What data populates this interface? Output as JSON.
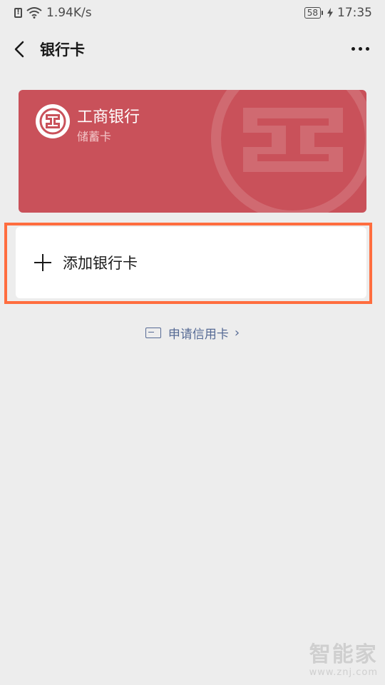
{
  "status_bar": {
    "network_speed": "1.94K/s",
    "battery": "58",
    "time": "17:35"
  },
  "nav": {
    "title": "银行卡"
  },
  "card": {
    "bank_name": "工商银行",
    "card_type": "储蓄卡",
    "color": "#c9515a"
  },
  "add_card": {
    "label": "添加银行卡"
  },
  "credit_link": {
    "label": "申请信用卡"
  },
  "watermark": {
    "title": "智能家",
    "url": "www.znj.com"
  },
  "colors": {
    "background": "#ededed",
    "link": "#576b95",
    "highlight": "#ff6d3f"
  }
}
